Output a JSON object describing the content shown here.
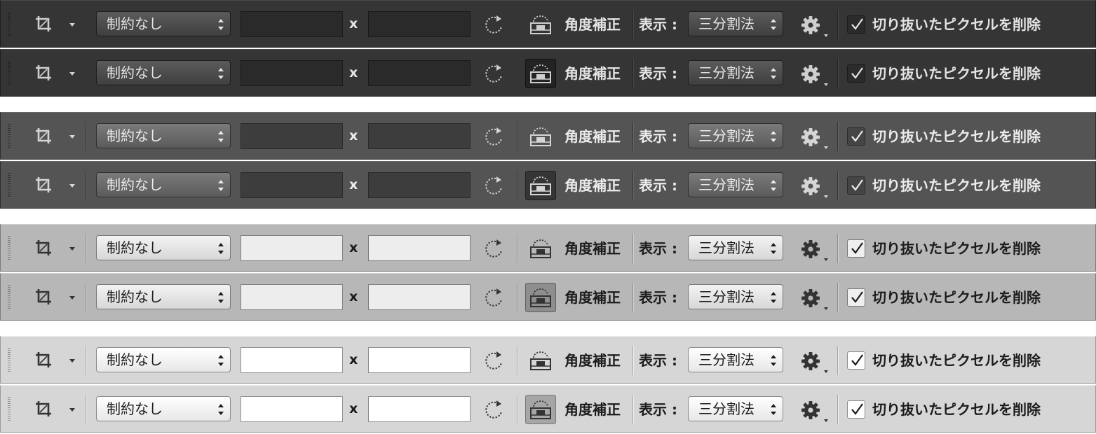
{
  "toolbar": {
    "aspect_preset": "制約なし",
    "width_value": "",
    "height_value": "",
    "times_symbol": "x",
    "straighten_label": "角度補正",
    "view_label": "表示 :",
    "overlay_option": "三分割法",
    "delete_cropped_label": "切り抜いたピクセルを削除",
    "delete_cropped_checked": true
  },
  "themes": [
    {
      "name": "darkest",
      "background": "#353535"
    },
    {
      "name": "dark",
      "background": "#545454"
    },
    {
      "name": "medium",
      "background": "#b7b7b7"
    },
    {
      "name": "light",
      "background": "#d6d6d6"
    }
  ],
  "rows": [
    {
      "theme": 0,
      "straighten_active": false
    },
    {
      "theme": 0,
      "straighten_active": true
    },
    {
      "theme": 1,
      "straighten_active": false
    },
    {
      "theme": 1,
      "straighten_active": true
    },
    {
      "theme": 2,
      "straighten_active": false
    },
    {
      "theme": 2,
      "straighten_active": true
    },
    {
      "theme": 3,
      "straighten_active": false
    },
    {
      "theme": 3,
      "straighten_active": true
    }
  ]
}
